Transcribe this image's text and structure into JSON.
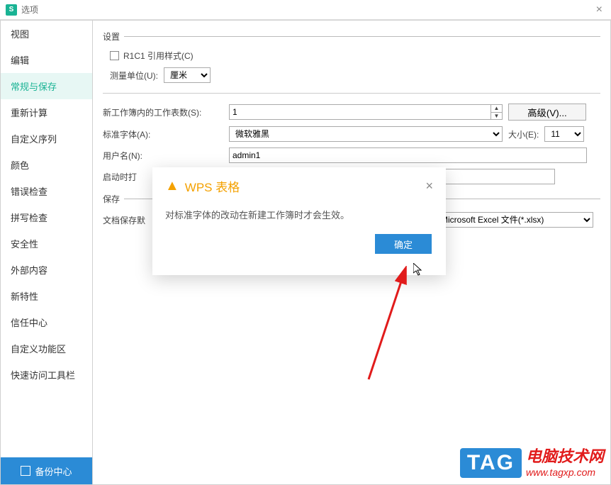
{
  "window": {
    "title": "选项",
    "close": "×"
  },
  "sidebar": {
    "items": [
      {
        "label": "视图"
      },
      {
        "label": "编辑"
      },
      {
        "label": "常规与保存",
        "selected": true
      },
      {
        "label": "重新计算"
      },
      {
        "label": "自定义序列"
      },
      {
        "label": "颜色"
      },
      {
        "label": "错误检查"
      },
      {
        "label": "拼写检查"
      },
      {
        "label": "安全性"
      },
      {
        "label": "外部内容"
      },
      {
        "label": "新特性"
      },
      {
        "label": "信任中心"
      },
      {
        "label": "自定义功能区"
      },
      {
        "label": "快速访问工具栏"
      }
    ],
    "backup": "备份中心"
  },
  "settings_section": "设置",
  "r1c1_label": "R1C1 引用样式(C)",
  "meas_label": "测量单位(U):",
  "meas_value": "厘米",
  "newwb_section_hr": true,
  "sheets_label": "新工作簿内的工作表数(S):",
  "sheets_value": "1",
  "adv_label": "高级(V)...",
  "font_label": "标准字体(A):",
  "font_value": "微软雅黑",
  "size_label": "大小(E):",
  "size_value": "11",
  "user_label": "用户名(N):",
  "user_value": "admin1",
  "open_label": "启动时打",
  "save_section": "保存",
  "save_default_label": "文档保存默",
  "save_type": "Microsoft Excel 文件(*.xlsx)",
  "dialog": {
    "title": "WPS 表格",
    "message": "对标准字体的改动在新建工作簿时才会生效。",
    "ok": "确定",
    "close": "×"
  },
  "tag": {
    "box": "TAG",
    "line1": "电脑技术网",
    "line2": "www.tagxp.com"
  }
}
